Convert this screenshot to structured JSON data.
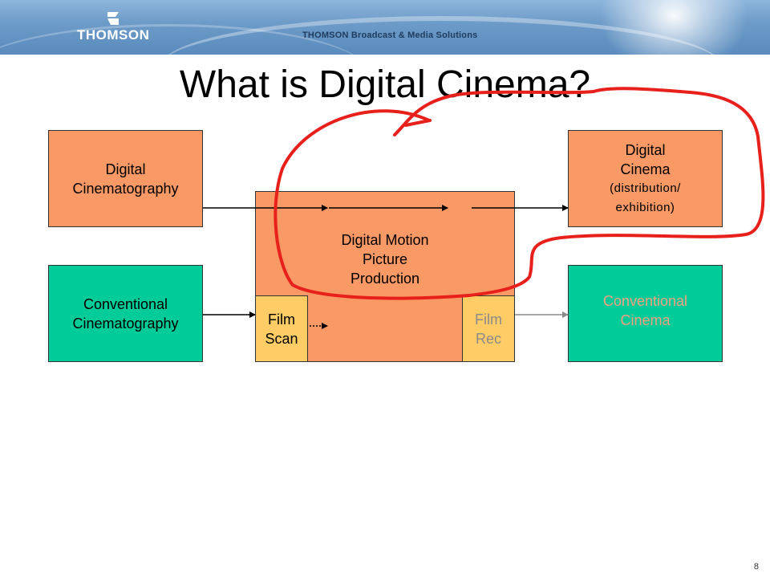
{
  "header": {
    "logo_text": "THOMSON",
    "tagline": "THOMSON Broadcast & Media Solutions"
  },
  "slide": {
    "title": "What is Digital Cinema?",
    "page_number": "8"
  },
  "diagram": {
    "digital_cinematography": [
      "Digital",
      "Cinematography"
    ],
    "conventional_cinematography": [
      "Conventional",
      "Cinematography"
    ],
    "production": [
      "Digital Motion",
      "Picture",
      "Production"
    ],
    "film_scan": [
      "Film",
      "Scan"
    ],
    "film_rec": [
      "Film",
      "Rec"
    ],
    "digital_cinema": [
      "Digital",
      "Cinema"
    ],
    "digital_cinema_sub": [
      "(distribution/",
      "exhibition)"
    ],
    "conventional_cinema": [
      "Conventional",
      "Cinema"
    ]
  },
  "colors": {
    "box_orange": "#f99966",
    "box_green": "#00cc99",
    "box_yellow": "#ffcc66",
    "annotation_red": "#e8201c"
  }
}
